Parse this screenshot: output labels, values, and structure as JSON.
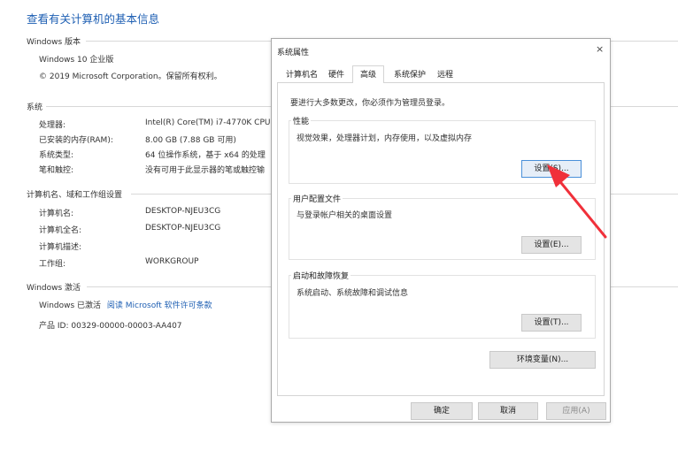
{
  "page": {
    "title": "查看有关计算机的基本信息",
    "windows_edition": {
      "heading": "Windows 版本",
      "edition": "Windows 10 企业版",
      "copyright": "© 2019 Microsoft Corporation。保留所有权利。"
    },
    "system": {
      "heading": "系统",
      "rows": [
        {
          "label": "处理器:",
          "value": "Intel(R) Core(TM) i7-4770K CPU"
        },
        {
          "label": "已安装的内存(RAM):",
          "value": "8.00 GB (7.88 GB 可用)"
        },
        {
          "label": "系统类型:",
          "value": "64 位操作系统，基于 x64 的处理"
        },
        {
          "label": "笔和触控:",
          "value": "没有可用于此显示器的笔或触控输"
        }
      ]
    },
    "computer_name": {
      "heading": "计算机名、域和工作组设置",
      "rows": [
        {
          "label": "计算机名:",
          "value": "DESKTOP-NJEU3CG"
        },
        {
          "label": "计算机全名:",
          "value": "DESKTOP-NJEU3CG"
        },
        {
          "label": "计算机描述:",
          "value": ""
        },
        {
          "label": "工作组:",
          "value": "WORKGROUP"
        }
      ]
    },
    "activation": {
      "heading": "Windows 激活",
      "status": "Windows 已激活",
      "link": "阅读 Microsoft 软件许可条款",
      "product_id": "产品 ID: 00329-00000-00003-AA407"
    }
  },
  "dialog": {
    "title": "系统属性",
    "close": "×",
    "tabs": [
      "计算机名",
      "硬件",
      "高级",
      "系统保护",
      "远程"
    ],
    "active_tab": "高级",
    "admin_note": "要进行大多数更改，你必须作为管理员登录。",
    "performance": {
      "title": "性能",
      "desc": "视觉效果，处理器计划，内存使用，以及虚拟内存",
      "button": "设置(S)..."
    },
    "user_profiles": {
      "title": "用户配置文件",
      "desc": "与登录帐户相关的桌面设置",
      "button": "设置(E)..."
    },
    "startup_recovery": {
      "title": "启动和故障恢复",
      "desc": "系统启动、系统故障和调试信息",
      "button": "设置(T)..."
    },
    "env_button": "环境变量(N)...",
    "ok": "确定",
    "cancel": "取消",
    "apply": "应用(A)"
  },
  "colors": {
    "link": "#1e5fb3",
    "annotation_arrow": "#f0303a"
  },
  "icons": {
    "close": "close-icon",
    "annotation": "red-arrow-annotation-icon"
  }
}
